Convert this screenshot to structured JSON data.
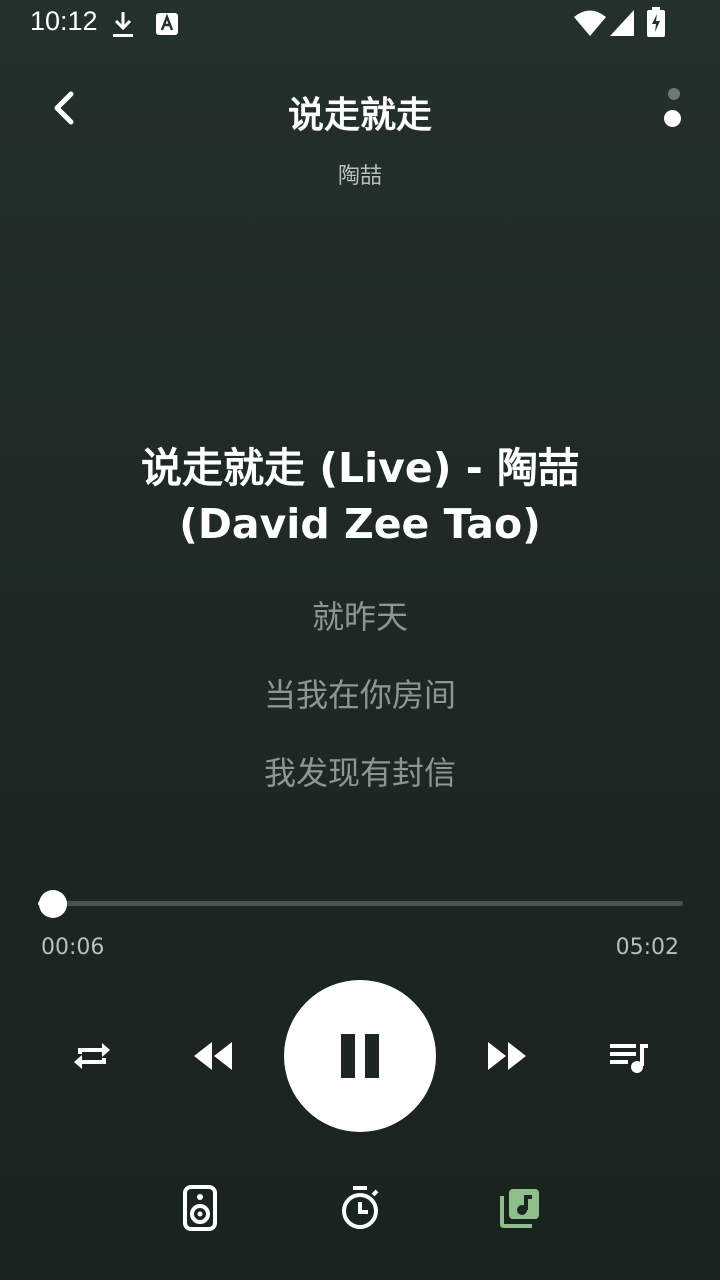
{
  "status_bar": {
    "time": "10:12",
    "icons": [
      "download-icon",
      "keyboard-a-icon",
      "wifi-icon",
      "signal-icon",
      "battery-charging-icon"
    ]
  },
  "header": {
    "back_icon": "chevron-left-icon",
    "title": "说走就走",
    "artist": "陶喆",
    "more_icon": "more-dots-icon"
  },
  "lyrics": {
    "title_line1": "说走就走 (Live) - 陶喆",
    "title_line2": "(David Zee Tao)",
    "lines": [
      "就昨天",
      "当我在你房间",
      "我发现有封信"
    ]
  },
  "progress": {
    "current": "00:06",
    "total": "05:02",
    "fraction": 0.02
  },
  "controls": {
    "repeat": "repeat-icon",
    "previous": "rewind-icon",
    "play_pause": "pause-icon",
    "next": "fast-forward-icon",
    "playlist": "playlist-icon"
  },
  "bottom_bar": {
    "speaker": "speaker-icon",
    "timer": "timer-icon",
    "library": "music-library-icon",
    "accent_color": "#8fbf8a"
  }
}
